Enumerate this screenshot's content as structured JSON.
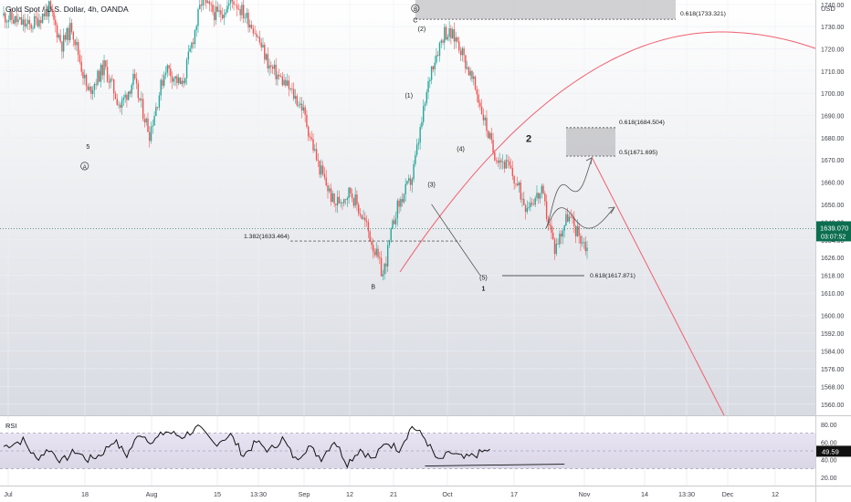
{
  "header": {
    "title": "Gold Spot / U.S. Dollar, 4h, OANDA"
  },
  "chart_data": [
    {
      "type": "candlestick",
      "currency_label": "USD",
      "ylim": [
        1555,
        1742
      ],
      "y_ticks": [
        1740,
        1730,
        1720,
        1710,
        1700,
        1690,
        1680,
        1670,
        1660,
        1650,
        1642,
        1634,
        1626,
        1618,
        1610,
        1600,
        1592,
        1584,
        1576,
        1568,
        1560
      ],
      "x_ticks": [
        "Jul",
        "18",
        "Aug",
        "15",
        "13:30",
        "Sep",
        "12",
        "21",
        "Oct",
        "17",
        "Nov",
        "14",
        "13:30",
        "Dec",
        "12"
      ],
      "last_price": {
        "value": "1639.070",
        "countdown": "03:07:52",
        "color": "#0b6e4f"
      },
      "path_keys": [
        [
          0,
          1735
        ],
        [
          8,
          1730
        ],
        [
          14,
          1738
        ],
        [
          18,
          1722
        ],
        [
          21,
          1730
        ],
        [
          26,
          1700
        ],
        [
          31,
          1712
        ],
        [
          36,
          1694
        ],
        [
          40,
          1706
        ],
        [
          45,
          1682
        ],
        [
          50,
          1712
        ],
        [
          55,
          1703
        ],
        [
          61,
          1741
        ],
        [
          66,
          1735
        ],
        [
          71,
          1742
        ],
        [
          77,
          1730
        ],
        [
          82,
          1712
        ],
        [
          87,
          1704
        ],
        [
          92,
          1694
        ],
        [
          97,
          1668
        ],
        [
          102,
          1650
        ],
        [
          107,
          1656
        ],
        [
          112,
          1640
        ],
        [
          117,
          1618
        ],
        [
          121,
          1647
        ],
        [
          126,
          1662
        ],
        [
          132,
          1712
        ],
        [
          136,
          1728
        ],
        [
          140,
          1724
        ],
        [
          146,
          1700
        ],
        [
          151,
          1674
        ],
        [
          156,
          1666
        ],
        [
          161,
          1650
        ],
        [
          166,
          1655
        ],
        [
          170,
          1630
        ],
        [
          174,
          1645
        ],
        [
          180,
          1630
        ]
      ],
      "series": [
        {
          "name": "",
          "kind": "candles",
          "up_color": "#26a69a",
          "down_color": "#ef5350"
        },
        {
          "name": "",
          "kind": "arc",
          "color": "#f06070"
        }
      ],
      "annotations": {
        "wave_labels": [
          {
            "text": "5",
            "bar": 26,
            "price": 1675
          },
          {
            "text": "A",
            "bar": 25,
            "price": 1666,
            "circled": true
          },
          {
            "text": "B",
            "bar": 127,
            "price": 1737,
            "circled": true
          },
          {
            "text": "C",
            "bar": 127,
            "price": 1732
          },
          {
            "text": "(2)",
            "bar": 129,
            "price": 1728
          },
          {
            "text": "(1)",
            "bar": 125,
            "price": 1698
          },
          {
            "text": "(3)",
            "bar": 132,
            "price": 1658
          },
          {
            "text": "(4)",
            "bar": 141,
            "price": 1674
          },
          {
            "text": "(5)",
            "bar": 148,
            "price": 1616
          },
          {
            "text": "B",
            "bar": 114,
            "price": 1612
          },
          {
            "text": "1",
            "bar": 148,
            "price": 1611,
            "bold": true
          },
          {
            "text": "2",
            "bar": 162,
            "price": 1678,
            "bold": true,
            "large": true
          }
        ],
        "fib_levels": [
          {
            "text": "0.618(1733.321)",
            "price": 1733.321
          },
          {
            "text": "0.618(1684.504)",
            "price": 1684.504
          },
          {
            "text": "0.5(1671.695)",
            "price": 1671.695
          },
          {
            "text": "1.382(1633.464)",
            "price": 1633.464
          },
          {
            "text": "0.618(1617.871)",
            "price": 1617.871
          }
        ]
      }
    },
    {
      "type": "line",
      "title": "RSI",
      "ylim": [
        15,
        85
      ],
      "y_ticks": [
        80,
        60,
        40,
        20
      ],
      "last_value": "49.59",
      "series": [
        {
          "name": "",
          "color": "#111111",
          "x": [
            0,
            6,
            10,
            14,
            18,
            22,
            26,
            30,
            34,
            38,
            42,
            46,
            50,
            55,
            60,
            65,
            70,
            74,
            78,
            82,
            86,
            90,
            94,
            98,
            102,
            106,
            110,
            114,
            118,
            122,
            126,
            130,
            134,
            138,
            142,
            146,
            150
          ],
          "values": [
            55,
            62,
            41,
            52,
            38,
            50,
            40,
            46,
            62,
            45,
            70,
            60,
            72,
            66,
            76,
            58,
            68,
            45,
            60,
            50,
            64,
            40,
            55,
            42,
            62,
            36,
            52,
            40,
            60,
            52,
            78,
            64,
            38,
            48,
            41,
            46,
            52
          ]
        }
      ]
    }
  ]
}
